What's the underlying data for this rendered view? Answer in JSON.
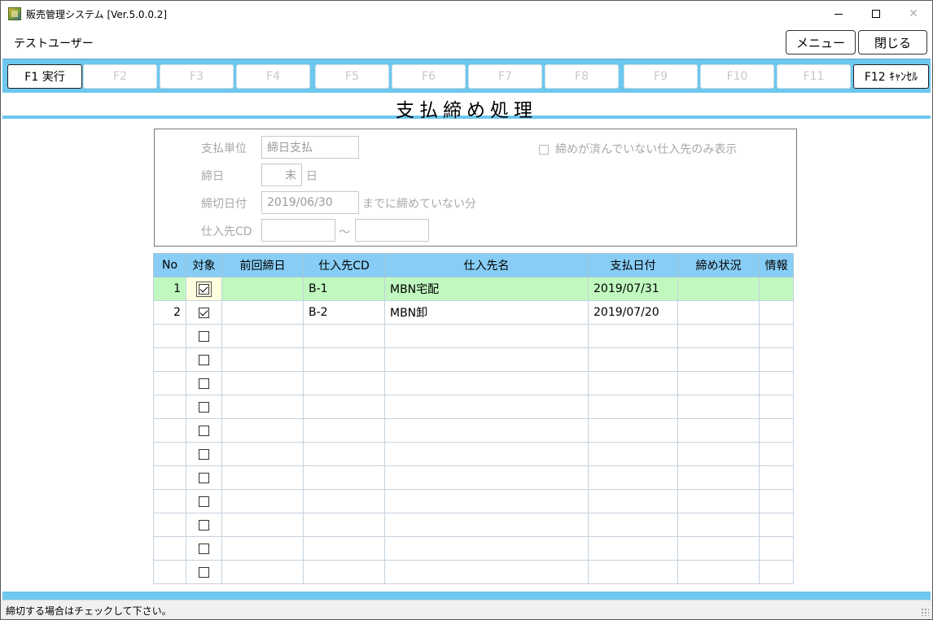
{
  "window": {
    "title": "販売管理システム [Ver.5.0.0.2]",
    "minimize_glyph": "",
    "close_glyph": "✕"
  },
  "header": {
    "user_name": "テストユーザー",
    "menu_label": "メニュー",
    "close_label": "閉じる"
  },
  "fkeys": [
    {
      "label": "F1 実行",
      "enabled": true
    },
    {
      "label": "F2",
      "enabled": false
    },
    {
      "label": "F3",
      "enabled": false
    },
    {
      "label": "F4",
      "enabled": false
    },
    {
      "label": "F5",
      "enabled": false
    },
    {
      "label": "F6",
      "enabled": false
    },
    {
      "label": "F7",
      "enabled": false
    },
    {
      "label": "F8",
      "enabled": false
    },
    {
      "label": "F9",
      "enabled": false
    },
    {
      "label": "F10",
      "enabled": false
    },
    {
      "label": "F11",
      "enabled": false
    },
    {
      "label": "F12 ｷｬﾝｾﾙ",
      "enabled": true
    }
  ],
  "page_title": "支払締め処理",
  "filter": {
    "payment_unit_label": "支払単位",
    "payment_unit_value": "締日支払",
    "closing_day_label": "締日",
    "closing_day_value": "末",
    "closing_day_suffix": "日",
    "cutoff_date_label": "締切日付",
    "cutoff_date_value": "2019/06/30",
    "cutoff_date_suffix": "までに締めていない分",
    "supplier_cd_label": "仕入先CD",
    "supplier_cd_from": "",
    "supplier_cd_to": "",
    "range_separator": "～",
    "unclosed_only_label": "締めが済んでいない仕入先のみ表示",
    "unclosed_only_checked": false
  },
  "table": {
    "columns": [
      "No",
      "対象",
      "前回締日",
      "仕入先CD",
      "仕入先名",
      "支払日付",
      "締め状況",
      "情報"
    ],
    "rows": [
      {
        "no": "1",
        "checked": true,
        "prev_close": "",
        "supplier_cd": "B-1",
        "supplier_name": "MBN宅配",
        "pay_date": "2019/07/31",
        "status": "",
        "info": "",
        "selected": true
      },
      {
        "no": "2",
        "checked": true,
        "prev_close": "",
        "supplier_cd": "B-2",
        "supplier_name": "MBN卸",
        "pay_date": "2019/07/20",
        "status": "",
        "info": "",
        "selected": false
      }
    ],
    "empty_rows": 11
  },
  "status_bar": {
    "message": "締切する場合はチェックして下さい。"
  },
  "colors": {
    "accent": "#6dc7ee",
    "header_bg": "#87cdf5",
    "selected_row": "#c0f8c0"
  }
}
